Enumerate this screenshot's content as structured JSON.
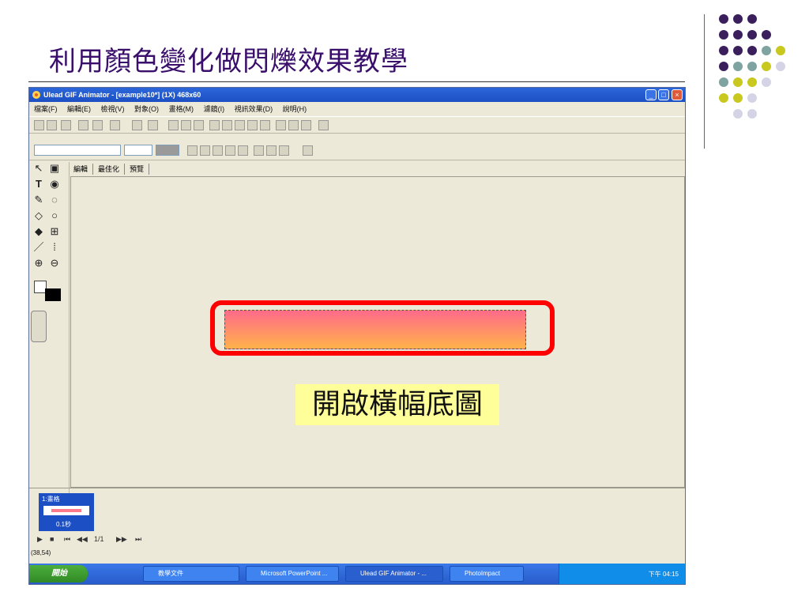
{
  "slide": {
    "title": "利用顏色變化做閃爍效果教學",
    "caption": "開啟橫幅底圖",
    "dot_colors": [
      "#3a1f5c",
      "#7fa3a0",
      "#c8c81e",
      "#d4d4e6"
    ]
  },
  "app": {
    "window_title": "Ulead GIF Animator - [example10*] (1X) 468x60",
    "menu": [
      "檔案(F)",
      "編輯(E)",
      "檢視(V)",
      "對象(O)",
      "畫格(M)",
      "濾鏡(I)",
      "視訊效果(D)",
      "說明(H)"
    ],
    "tabs": [
      "編輯",
      "最佳化",
      "預覽"
    ],
    "frame_label": "1:畫格",
    "frame_delay": "0.1秒",
    "frame_counter": "1/1",
    "status_coords": "(38,54)"
  },
  "taskbar": {
    "start_label": "開始",
    "tasks": [
      "教學文件",
      "Microsoft PowerPoint ...",
      "Ulead GIF Animator - ...",
      "PhotoImpact"
    ],
    "clock": "下午 04:15"
  }
}
